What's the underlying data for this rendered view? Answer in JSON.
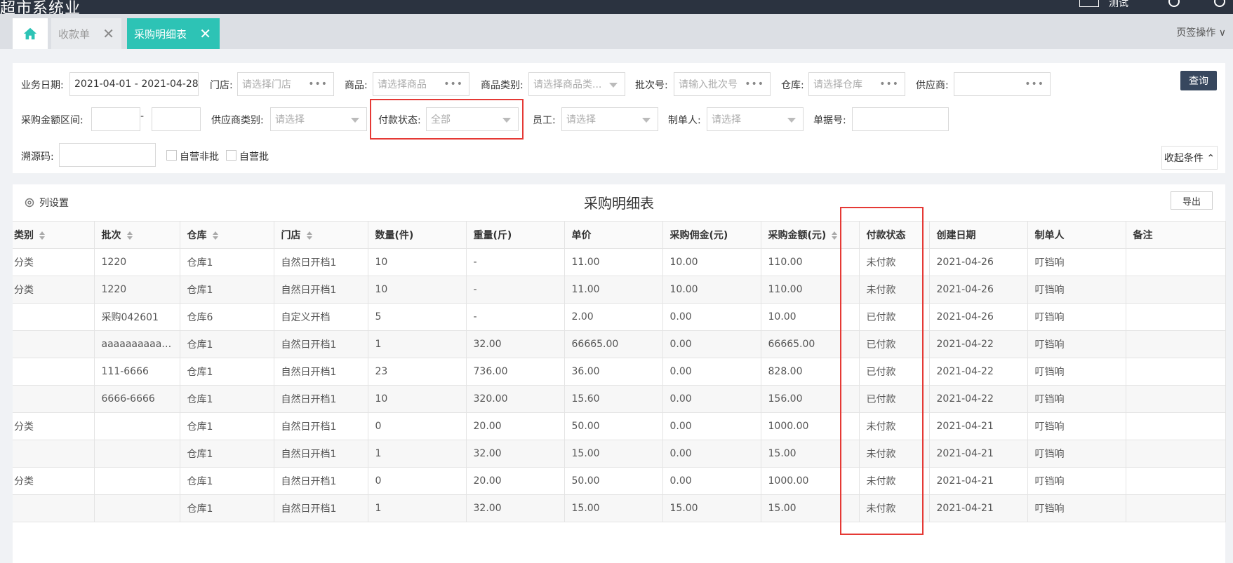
{
  "header": {
    "app_title": "超市系统业",
    "user_name": "测试",
    "colors": {
      "header_bg": "#2b3340",
      "accent": "#2dc3b5"
    }
  },
  "tabs": {
    "home_icon": "home-icon",
    "items": [
      {
        "label": "收款单",
        "active": false
      },
      {
        "label": "采购明细表",
        "active": true
      }
    ],
    "close_glyph": "✕",
    "page_ops": "页签操作 ∨"
  },
  "filters": {
    "biz_date_label": "业务日期:",
    "biz_date_value": "2021-04-01 - 2021-04-28",
    "store_label": "门店:",
    "store_ph": "请选择门店",
    "product_label": "商品:",
    "product_ph": "请选择商品",
    "category_label": "商品类别:",
    "category_ph": "请选择商品类...",
    "batch_label": "批次号:",
    "batch_ph": "请输入批次号",
    "warehouse_label": "仓库:",
    "warehouse_ph": "请选择仓库",
    "supplier_label": "供应商:",
    "query_btn": "查询",
    "amount_range_label": "采购金额区间:",
    "amount_sep": "-",
    "supplier_cat_label": "供应商类别:",
    "supplier_cat_ph": "请选择",
    "pay_status_label": "付款状态:",
    "pay_status_value": "全部",
    "employee_label": "员工:",
    "employee_ph": "请选择",
    "creator_label": "制单人:",
    "creator_ph": "请选择",
    "doc_no_label": "单据号:",
    "trace_label": "溯源码:",
    "self_nonbatch_label": "自营非批",
    "self_batch_label": "自营批",
    "collapse_btn": "收起条件 ⌃",
    "dots": "•••"
  },
  "table": {
    "col_settings": "列设置",
    "title": "采购明细表",
    "export_btn": "导出",
    "columns": [
      "类别",
      "批次",
      "仓库",
      "门店",
      "数量(件)",
      "重量(斤)",
      "单价",
      "采购佣金(元)",
      "采购金额(元)",
      "付款状态",
      "创建日期",
      "制单人",
      "备注"
    ],
    "rows": [
      [
        "分类",
        "1220",
        "仓库1",
        "自然日开档1",
        "10",
        "-",
        "11.00",
        "10.00",
        "110.00",
        "未付款",
        "2021-04-26",
        "叮铛响",
        ""
      ],
      [
        "分类",
        "1220",
        "仓库1",
        "自然日开档1",
        "10",
        "-",
        "11.00",
        "10.00",
        "110.00",
        "未付款",
        "2021-04-26",
        "叮铛响",
        ""
      ],
      [
        "",
        "采购042601",
        "仓库6",
        "自定义开档",
        "5",
        "-",
        "2.00",
        "0.00",
        "10.00",
        "已付款",
        "2021-04-26",
        "叮铛响",
        ""
      ],
      [
        "",
        "aaaaaaaaaaa...",
        "仓库1",
        "自然日开档1",
        "1",
        "32.00",
        "66665.00",
        "0.00",
        "66665.00",
        "已付款",
        "2021-04-22",
        "叮铛响",
        ""
      ],
      [
        "",
        "111-6666",
        "仓库1",
        "自然日开档1",
        "23",
        "736.00",
        "36.00",
        "0.00",
        "828.00",
        "已付款",
        "2021-04-22",
        "叮铛响",
        ""
      ],
      [
        "",
        "6666-6666",
        "仓库1",
        "自然日开档1",
        "10",
        "320.00",
        "15.60",
        "0.00",
        "156.00",
        "已付款",
        "2021-04-22",
        "叮铛响",
        ""
      ],
      [
        "分类",
        "",
        "仓库1",
        "自然日开档1",
        "0",
        "20.00",
        "50.00",
        "0.00",
        "1000.00",
        "未付款",
        "2021-04-21",
        "叮铛响",
        ""
      ],
      [
        "",
        "",
        "仓库1",
        "自然日开档1",
        "1",
        "32.00",
        "15.00",
        "0.00",
        "15.00",
        "未付款",
        "2021-04-21",
        "叮铛响",
        ""
      ],
      [
        "分类",
        "",
        "仓库1",
        "自然日开档1",
        "0",
        "20.00",
        "50.00",
        "0.00",
        "1000.00",
        "未付款",
        "2021-04-21",
        "叮铛响",
        ""
      ],
      [
        "",
        "",
        "仓库1",
        "自然日开档1",
        "1",
        "32.00",
        "15.00",
        "15.00",
        "15.00",
        "未付款",
        "2021-04-21",
        "叮铛响",
        ""
      ]
    ]
  }
}
